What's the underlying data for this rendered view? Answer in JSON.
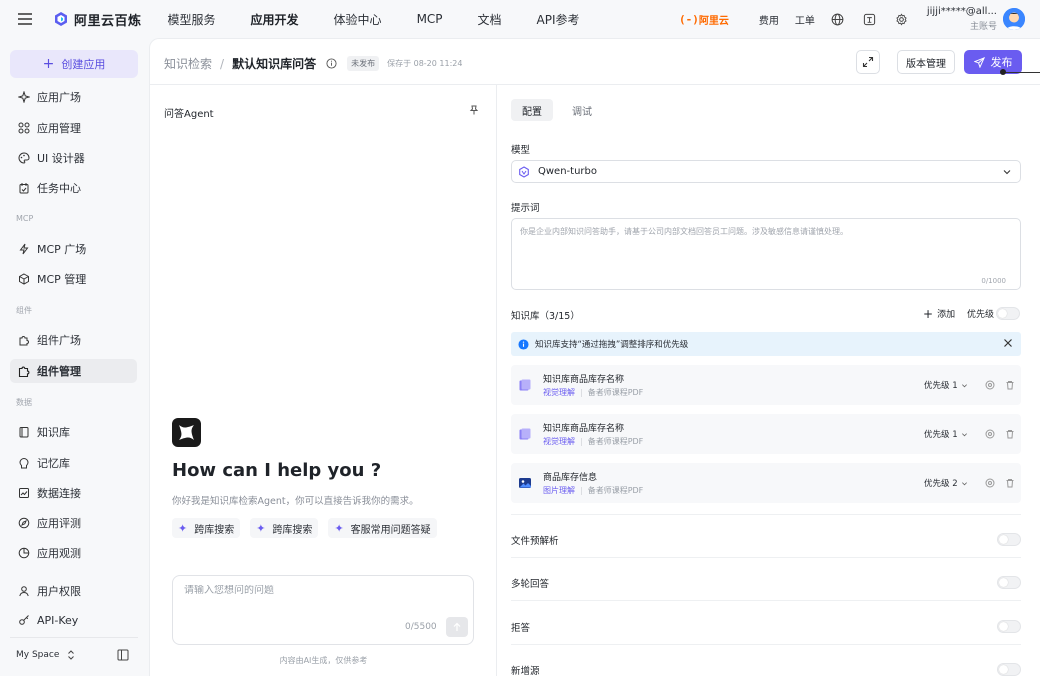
{
  "topbar": {
    "brand": "阿里云百炼",
    "nav": [
      "模型服务",
      "应用开发",
      "体验中心",
      "MCP",
      "文档",
      "API参考"
    ],
    "active_nav": 1,
    "aliyun": "阿里云",
    "links": [
      "费用",
      "工单"
    ],
    "account_name": "jijji*****@all...",
    "account_role": "主账号"
  },
  "sidebar": {
    "create_label": "创建应用",
    "groups": [
      {
        "section": "",
        "items": [
          {
            "label": "应用广场",
            "icon": "sparkle-icon"
          },
          {
            "label": "应用管理",
            "icon": "apps-grid-icon"
          },
          {
            "label": "UI 设计器",
            "icon": "palette-icon"
          },
          {
            "label": "任务中心",
            "icon": "task-icon"
          }
        ]
      },
      {
        "section": "MCP",
        "items": [
          {
            "label": "MCP 广场",
            "icon": "bolt-icon"
          },
          {
            "label": "MCP 管理",
            "icon": "cube-icon"
          }
        ]
      },
      {
        "section": "组件",
        "items": [
          {
            "label": "组件广场",
            "icon": "puzzle-icon"
          },
          {
            "label": "组件管理",
            "icon": "puzzle-manage-icon"
          }
        ]
      },
      {
        "section": "数据",
        "items": [
          {
            "label": "知识库",
            "icon": "book-icon"
          },
          {
            "label": "记忆库",
            "icon": "memory-icon"
          },
          {
            "label": "数据连接",
            "icon": "chart-line-icon"
          },
          {
            "label": "应用评测",
            "icon": "compass-icon"
          },
          {
            "label": "应用观测",
            "icon": "pie-icon"
          }
        ]
      },
      {
        "section": "",
        "items": [
          {
            "label": "用户权限",
            "icon": "user-icon"
          },
          {
            "label": "API-Key",
            "icon": "key-icon"
          }
        ]
      }
    ],
    "active_item": "组件管理",
    "space": "My Space"
  },
  "header": {
    "crumb_parent": "知识检索",
    "crumb_sep": "/",
    "crumb_current": "默认知识库问答",
    "status": "未发布",
    "saved": "保存于 08-20 11:24",
    "version_label": "版本管理",
    "publish_label": "发布"
  },
  "preview": {
    "title": "问答Agent",
    "hero": "How can I help you ?",
    "sub": "你好我是知识库检索Agent，你可以直接告诉我你的需求。",
    "chips": [
      "跨库搜索",
      "跨库搜索",
      "客服常用问题答疑"
    ],
    "input_placeholder": "请输入您想问的问题",
    "input_count": "0/5500",
    "disclaimer": "内容由AI生成，仅供参考"
  },
  "config": {
    "tabs": [
      "配置",
      "调试"
    ],
    "model_label": "模型",
    "model_value": "Qwen-turbo",
    "prompt_label": "提示词",
    "prompt_text": "你是企业内部知识问答助手，请基于公司内部文档回答员工问题。涉及敏感信息请谨慎处理。",
    "prompt_count": "0/1000",
    "kb_label": "知识库（3/15）",
    "kb_add": "添加",
    "kb_priority": "优先级",
    "notice": "知识库支持“通过拖拽”调整排序和优先级",
    "kb_items": [
      {
        "title": "知识库商品库存名称",
        "tag": "视觉理解",
        "desc": "备者师课程PDF",
        "priority": "优先级 1",
        "icon": "book-stack-icon"
      },
      {
        "title": "知识库商品库存名称",
        "tag": "视觉理解",
        "desc": "备者师课程PDF",
        "priority": "优先级 1",
        "icon": "book-stack-icon"
      },
      {
        "title": "商品库存信息",
        "tag": "图片理解",
        "desc": "备者师课程PDF",
        "priority": "优先级 2",
        "icon": "image-icon"
      }
    ],
    "options": [
      "文件预解析",
      "多轮回答",
      "拒答",
      "新增源"
    ]
  },
  "colors": {
    "accent": "#6a5cf0",
    "aliyun": "#ff6a00",
    "notice_bg": "#e7f3fc"
  }
}
